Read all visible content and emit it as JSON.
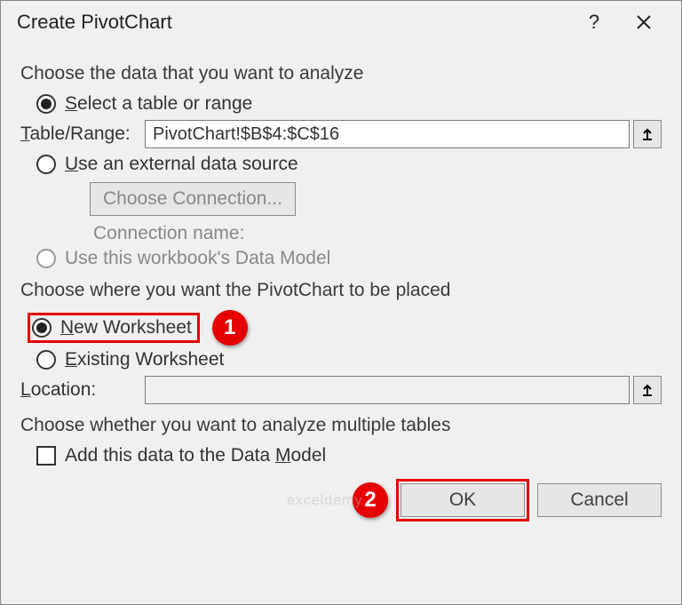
{
  "title": "Create PivotChart",
  "sections": {
    "analyze": {
      "label": "Choose the data that you want to analyze",
      "select_table": "Select a table or range",
      "table_range_label": "Table/Range:",
      "table_range_value": "PivotChart!$B$4:$C$16",
      "use_external": "Use an external data source",
      "choose_connection": "Choose Connection...",
      "connection_name_label": "Connection name:",
      "use_data_model": "Use this workbook's Data Model"
    },
    "placement": {
      "label": "Choose where you want the PivotChart to be placed",
      "new_worksheet": "New Worksheet",
      "existing_worksheet": "Existing Worksheet",
      "location_label": "Location:"
    },
    "multiple": {
      "label": "Choose whether you want to analyze multiple tables",
      "add_to_model": "Add this data to the Data Model"
    }
  },
  "buttons": {
    "ok": "OK",
    "cancel": "Cancel"
  },
  "callouts": {
    "one": "1",
    "two": "2"
  },
  "watermark": "exceldemy"
}
